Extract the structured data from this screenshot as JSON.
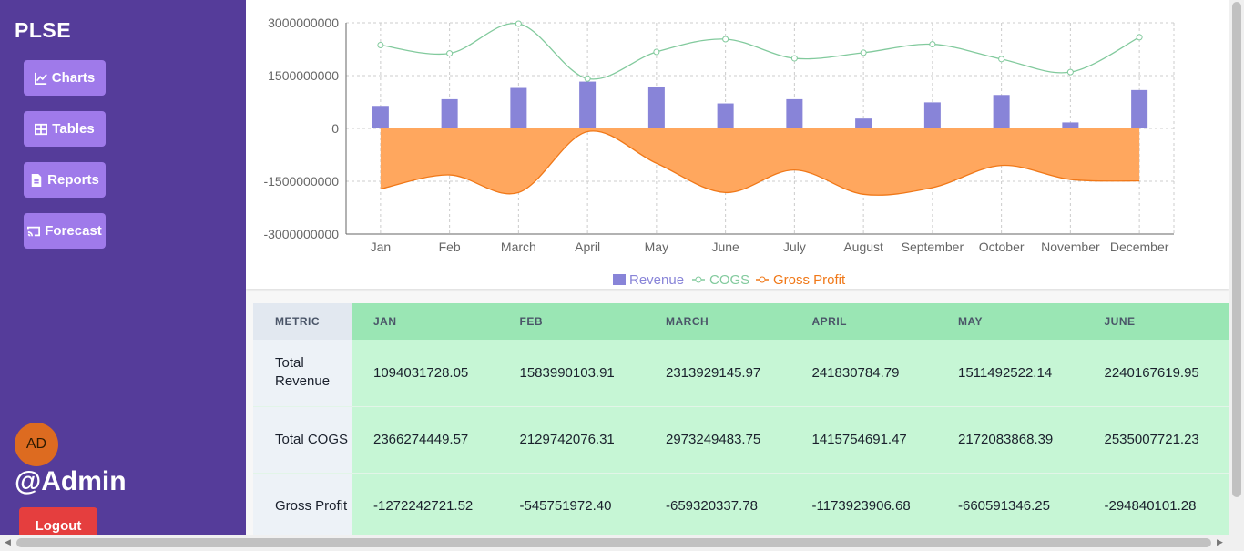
{
  "sidebar": {
    "brand": "PLSE",
    "nav": [
      {
        "label": "Charts",
        "icon": "line-chart-icon"
      },
      {
        "label": "Tables",
        "icon": "table-icon"
      },
      {
        "label": "Reports",
        "icon": "document-icon"
      },
      {
        "label": "Forecast",
        "icon": "cast-icon"
      }
    ],
    "avatar_initials": "AD",
    "username": "@Admin",
    "logout_label": "Logout"
  },
  "colors": {
    "sidebar_bg": "#553c9a",
    "nav_btn": "#9f7aea",
    "revenue": "#8884d8",
    "cogs": "#82ca9d",
    "gross_profit_fill": "#ffa75e",
    "gross_profit_line": "#f07818",
    "logout": "#e53e3e"
  },
  "chart_data": {
    "type": "bar",
    "categories": [
      "Jan",
      "Feb",
      "March",
      "April",
      "May",
      "June",
      "July",
      "August",
      "September",
      "October",
      "November",
      "December"
    ],
    "ylim": [
      -3000000000,
      3000000000
    ],
    "yticks": [
      -3000000000,
      -1500000000,
      0,
      1500000000,
      3000000000
    ],
    "grid": true,
    "legend_position": "bottom",
    "series": [
      {
        "name": "Revenue",
        "type": "bar",
        "values": [
          640000000,
          830000000,
          1150000000,
          1330000000,
          1190000000,
          710000000,
          830000000,
          280000000,
          740000000,
          950000000,
          170000000,
          1090000000
        ]
      },
      {
        "name": "COGS",
        "type": "line",
        "values": [
          2366274449.57,
          2129742076.31,
          2973249483.75,
          1415754691.47,
          2172083868.39,
          2535007721.23,
          1990000000,
          2150000000,
          2390000000,
          1970000000,
          1600000000,
          2590000000
        ]
      },
      {
        "name": "Gross Profit",
        "type": "area",
        "values": [
          -1720000000,
          -1320000000,
          -1820000000,
          -90000000,
          -990000000,
          -1820000000,
          -1180000000,
          -1870000000,
          -1680000000,
          -1050000000,
          -1450000000,
          -1490000000
        ]
      }
    ]
  },
  "table": {
    "headers": [
      "METRIC",
      "JAN",
      "FEB",
      "MARCH",
      "APRIL",
      "MAY",
      "JUNE"
    ],
    "rows": [
      {
        "metric": "Total Revenue",
        "values": [
          "1094031728.05",
          "1583990103.91",
          "2313929145.97",
          "241830784.79",
          "1511492522.14",
          "2240167619.95"
        ]
      },
      {
        "metric": "Total COGS",
        "values": [
          "2366274449.57",
          "2129742076.31",
          "2973249483.75",
          "1415754691.47",
          "2172083868.39",
          "2535007721.23"
        ]
      },
      {
        "metric": "Gross Profit",
        "values": [
          "-1272242721.52",
          "-545751972.40",
          "-659320337.78",
          "-1173923906.68",
          "-660591346.25",
          "-294840101.28"
        ]
      }
    ]
  }
}
